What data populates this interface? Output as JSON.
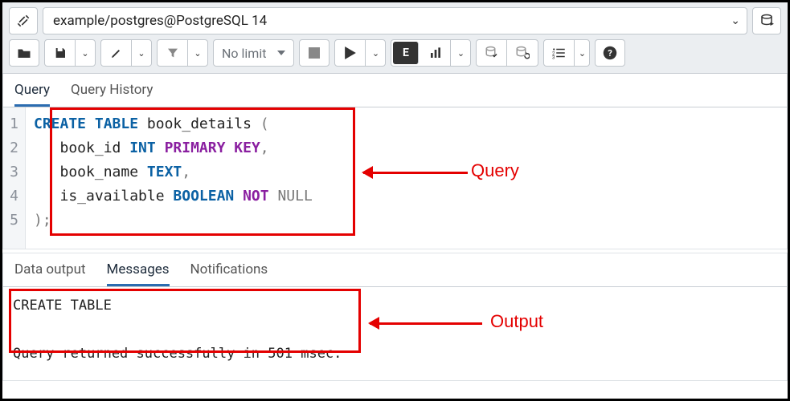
{
  "connection": {
    "label": "example/postgres@PostgreSQL 14"
  },
  "toolbar": {
    "limit_label": "No limit"
  },
  "editor_tabs": [
    {
      "label": "Query",
      "active": true
    },
    {
      "label": "Query History",
      "active": false
    }
  ],
  "code": {
    "lines": [
      {
        "n": "1",
        "tokens": [
          {
            "t": "CREATE",
            "c": "tok-kw"
          },
          {
            "t": " "
          },
          {
            "t": "TABLE",
            "c": "tok-kw"
          },
          {
            "t": " book_details "
          },
          {
            "t": "(",
            "c": "tok-gray"
          }
        ]
      },
      {
        "n": "2",
        "tokens": [
          {
            "t": "   book_id "
          },
          {
            "t": "INT",
            "c": "tok-kw"
          },
          {
            "t": " "
          },
          {
            "t": "PRIMARY",
            "c": "tok-kwp"
          },
          {
            "t": " "
          },
          {
            "t": "KEY",
            "c": "tok-kwp"
          },
          {
            "t": ",",
            "c": "tok-gray"
          }
        ]
      },
      {
        "n": "3",
        "tokens": [
          {
            "t": "   book_name "
          },
          {
            "t": "TEXT",
            "c": "tok-kw"
          },
          {
            "t": ",",
            "c": "tok-gray"
          }
        ]
      },
      {
        "n": "4",
        "tokens": [
          {
            "t": "   is_available "
          },
          {
            "t": "BOOLEAN",
            "c": "tok-kw"
          },
          {
            "t": " "
          },
          {
            "t": "NOT",
            "c": "tok-kwp"
          },
          {
            "t": " "
          },
          {
            "t": "NULL",
            "c": "tok-gray"
          }
        ]
      },
      {
        "n": "5",
        "tokens": [
          {
            "t": ");",
            "c": "tok-gray"
          }
        ]
      }
    ]
  },
  "result_tabs": [
    {
      "label": "Data output",
      "active": false
    },
    {
      "label": "Messages",
      "active": true
    },
    {
      "label": "Notifications",
      "active": false
    }
  ],
  "messages": {
    "line1": "CREATE TABLE",
    "line2": "Query returned successfully in 501 msec."
  },
  "annotations": {
    "query_label": "Query",
    "output_label": "Output"
  }
}
